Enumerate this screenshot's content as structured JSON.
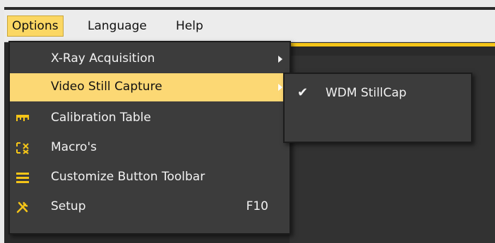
{
  "menubar": {
    "items": [
      {
        "label": "Options",
        "active": true
      },
      {
        "label": "Language",
        "active": false
      },
      {
        "label": "Help",
        "active": false
      }
    ]
  },
  "options_menu": {
    "items": [
      {
        "label": "X-Ray Acquisition",
        "icon": "none",
        "submenu": true
      },
      {
        "label": "Video Still Capture",
        "icon": "none",
        "submenu": true,
        "highlighted": true
      },
      {
        "label": "Calibration Table",
        "icon": "ruler-icon"
      },
      {
        "label": "Macro's",
        "icon": "macro-icon"
      },
      {
        "label": "Customize Button Toolbar",
        "icon": "hamburger-icon"
      },
      {
        "label": "Setup",
        "icon": "tools-icon",
        "shortcut": "F10"
      }
    ]
  },
  "video_still_submenu": {
    "items": [
      {
        "label": "WDM StillCap",
        "checked": true,
        "check_glyph": "✔"
      }
    ]
  },
  "colors": {
    "accent": "#f5c518",
    "highlight": "#fcd874",
    "menu_bg": "#3c3c3c",
    "icon": "#f5c518"
  }
}
